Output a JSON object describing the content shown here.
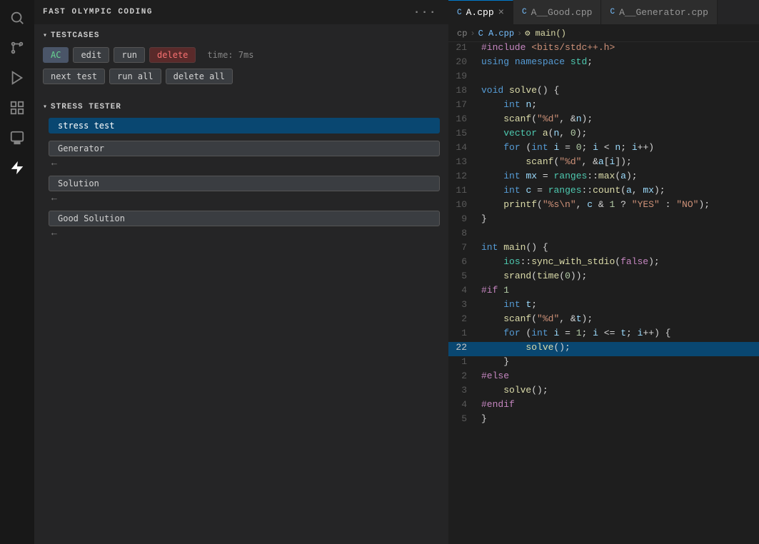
{
  "app": {
    "title": "FAST OLYMPIC CODING"
  },
  "activity_bar": {
    "icons": [
      {
        "name": "search-icon",
        "glyph": "🔍"
      },
      {
        "name": "source-control-icon",
        "glyph": "⎇"
      },
      {
        "name": "run-icon",
        "glyph": "▷"
      },
      {
        "name": "extensions-icon",
        "glyph": "⊞"
      },
      {
        "name": "remote-icon",
        "glyph": "⊡"
      },
      {
        "name": "lightning-icon",
        "glyph": "⚡"
      }
    ]
  },
  "sidebar": {
    "title": "FAST OLYMPIC CODING",
    "more": "···",
    "testcases": {
      "header": "TESTCASES",
      "buttons_row1": [
        {
          "label": "AC",
          "class": "btn-ac"
        },
        {
          "label": "edit",
          "class": "btn-edit"
        },
        {
          "label": "run",
          "class": "btn-run"
        },
        {
          "label": "delete",
          "class": "btn-delete"
        },
        {
          "label": "time: 7ms",
          "class": "btn-time"
        }
      ],
      "buttons_row2": [
        {
          "label": "next test"
        },
        {
          "label": "run all"
        },
        {
          "label": "delete all"
        }
      ]
    },
    "stress_tester": {
      "header": "STRESS TESTER",
      "items": [
        {
          "label": "stress test",
          "active": true,
          "has_arrow": false
        },
        {
          "label": "Generator",
          "active": false,
          "has_arrow": true
        },
        {
          "label": "Solution",
          "active": false,
          "has_arrow": true
        },
        {
          "label": "Good Solution",
          "active": false,
          "has_arrow": true
        }
      ]
    }
  },
  "tabs": [
    {
      "label": "A.cpp",
      "active": true,
      "icon": "C",
      "closable": true
    },
    {
      "label": "A__Good.cpp",
      "active": false,
      "icon": "C",
      "closable": false
    },
    {
      "label": "A__Generator.cpp",
      "active": false,
      "icon": "C",
      "closable": false
    }
  ],
  "breadcrumb": {
    "parts": [
      "cp",
      ">",
      "C A.cpp",
      ">",
      "⚙ main()"
    ]
  },
  "code": {
    "lines": [
      {
        "num": 21,
        "content": "#include <bits/stdc++.h>",
        "type": "include"
      },
      {
        "num": 20,
        "content": "using namespace std;",
        "type": "using"
      },
      {
        "num": 19,
        "content": "",
        "type": "empty"
      },
      {
        "num": 18,
        "content": "void solve() {",
        "type": "fn-def"
      },
      {
        "num": 17,
        "content": "    int n;",
        "type": "var-decl"
      },
      {
        "num": 16,
        "content": "    scanf(\"%d\", &n);",
        "type": "call"
      },
      {
        "num": 15,
        "content": "    vector a(n, 0);",
        "type": "call"
      },
      {
        "num": 14,
        "content": "    for (int i = 0; i < n; i++)",
        "type": "for"
      },
      {
        "num": 13,
        "content": "        scanf(\"%d\", &a[i]);",
        "type": "call"
      },
      {
        "num": 12,
        "content": "    int mx = ranges::max(a);",
        "type": "var-decl"
      },
      {
        "num": 11,
        "content": "    int c = ranges::count(a, mx);",
        "type": "var-decl"
      },
      {
        "num": 10,
        "content": "    printf(\"%s\\n\", c & 1 ? \"YES\" : \"NO\");",
        "type": "call"
      },
      {
        "num": 9,
        "content": "}",
        "type": "brace"
      },
      {
        "num": 8,
        "content": "",
        "type": "empty"
      },
      {
        "num": 7,
        "content": "int main() {",
        "type": "fn-def"
      },
      {
        "num": 6,
        "content": "    ios::sync_with_stdio(false);",
        "type": "call"
      },
      {
        "num": 5,
        "content": "    srand(time(0));",
        "type": "call"
      },
      {
        "num": 4,
        "content": "#if 1",
        "type": "macro"
      },
      {
        "num": 3,
        "content": "    int t;",
        "type": "var-decl"
      },
      {
        "num": 2,
        "content": "    scanf(\"%d\", &t);",
        "type": "call"
      },
      {
        "num": 1,
        "content": "    for (int i = 1; i <= t; i++) {",
        "type": "for-highlight"
      },
      {
        "num": 22,
        "content": "        solve();",
        "type": "call-highlight"
      },
      {
        "num": 1,
        "content": "    }",
        "type": "brace"
      },
      {
        "num": 2,
        "content": "#else",
        "type": "macro"
      },
      {
        "num": 3,
        "content": "    solve();",
        "type": "call"
      },
      {
        "num": 4,
        "content": "#endif",
        "type": "macro"
      },
      {
        "num": 5,
        "content": "}",
        "type": "brace"
      }
    ]
  }
}
